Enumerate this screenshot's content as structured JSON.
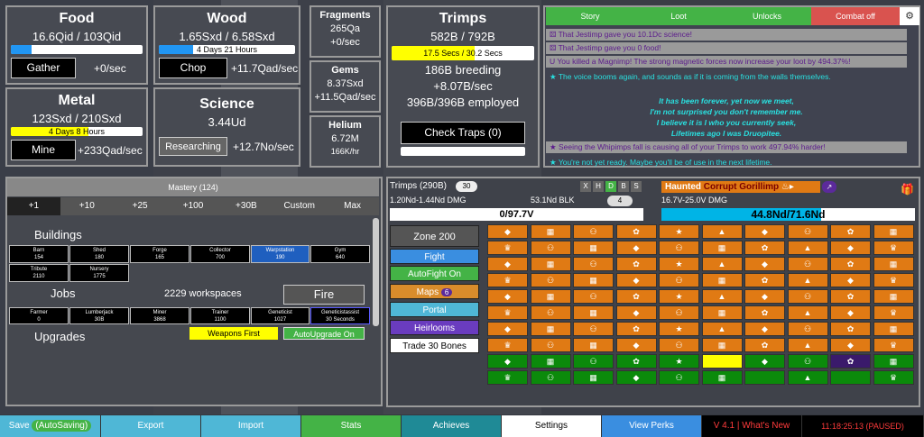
{
  "colors": {
    "accent_blue": "#2196f3",
    "yellow": "#ffff00",
    "orange": "#e07a14",
    "green": "#0b8a0b"
  },
  "food": {
    "title": "Food",
    "amount": "16.6Qid / 103Qid",
    "button": "Gather",
    "rate": "+0/sec",
    "fill": 0.16
  },
  "wood": {
    "title": "Wood",
    "amount": "1.65Sxd / 6.58Sxd",
    "bar_text": "4 Days 21 Hours",
    "button": "Chop",
    "rate": "+11.7Qad/sec",
    "fill": 0.25
  },
  "metal": {
    "title": "Metal",
    "amount": "123Sxd / 210Sxd",
    "bar_text": "4 Days 8 Hours",
    "button": "Mine",
    "rate": "+233Qad/sec",
    "fill": 0.59
  },
  "science": {
    "title": "Science",
    "amount": "3.44Ud",
    "button": "Researching",
    "rate": "+12.7No/sec"
  },
  "fragments": {
    "title": "Fragments",
    "amount": "265Qa",
    "rate": "+0/sec"
  },
  "gems": {
    "title": "Gems",
    "amount": "8.37Sxd",
    "rate": "+11.5Qad/sec"
  },
  "helium": {
    "title": "Helium",
    "amount": "6.72M",
    "rate": "166K/hr"
  },
  "trimps": {
    "title": "Trimps",
    "amount": "582B / 792B",
    "bar_text": "17.5 Secs / 30.2 Secs",
    "fill": 0.58,
    "breeding": "186B breeding",
    "rate": "+8.07B/sec",
    "employed": "396B/396B employed",
    "check_traps": "Check Traps (0)"
  },
  "log": {
    "tabs": [
      "Story",
      "Loot",
      "Unlocks",
      "Combat off"
    ],
    "lines": [
      "That Jestimp gave you 10.1Dc science!",
      "That Jestimp gave you 0 food!",
      "You killed a Magnimp! The strong magnetic forces now increase your loot by 494.37%!",
      "The voice booms again, and sounds as if it is coming from the walls themselves."
    ],
    "poem": [
      "It has been forever, yet now we meet,",
      "I'm not surprised you don't remember me.",
      "I believe it is I who you currently seek,",
      "Lifetimes ago I was Druopitee."
    ],
    "line5": "Seeing the Whipimps fall is causing all of your Trimps to work 497.94% harder!",
    "line6": "You're not yet ready. Maybe you'll be of use in the next lifetime."
  },
  "mastery": {
    "label": "Mastery (124)",
    "tabs": [
      "+1",
      "+10",
      "+25",
      "+100",
      "+30B",
      "Custom",
      "Max"
    ]
  },
  "buildings": {
    "heading": "Buildings",
    "items": [
      {
        "name": "Barn",
        "count": "154"
      },
      {
        "name": "Shed",
        "count": "180"
      },
      {
        "name": "Forge",
        "count": "165"
      },
      {
        "name": "Collector",
        "count": "700"
      },
      {
        "name": "Warpstation",
        "count": "190"
      },
      {
        "name": "Gym",
        "count": "640"
      },
      {
        "name": "Tribute",
        "count": "2110"
      },
      {
        "name": "Nursery",
        "count": "1775"
      }
    ]
  },
  "jobs": {
    "heading": "Jobs",
    "workspaces": "2229 workspaces",
    "fire": "Fire",
    "items": [
      {
        "name": "Farmer",
        "count": "0"
      },
      {
        "name": "Lumberjack",
        "count": "30B"
      },
      {
        "name": "Miner",
        "count": "3868"
      },
      {
        "name": "Trainer",
        "count": "1100"
      },
      {
        "name": "Geneticist",
        "count": "1027"
      },
      {
        "name": "Geneticistassist",
        "count": "30 Seconds"
      }
    ]
  },
  "upgrades": {
    "heading": "Upgrades",
    "weapons_first": "Weapons First",
    "autoupgrade": "AutoUpgrade On"
  },
  "battle": {
    "trimps_label": "Trimps (290B)",
    "trimps_badge": "30",
    "stance": [
      "X",
      "H",
      "D",
      "B",
      "S"
    ],
    "trimp_dmg": "1.20Nd-1.44Nd DMG",
    "trimp_blk": "53.1Nd BLK",
    "trimp_badge2": "4",
    "trimp_hp": "0/97.7V",
    "enemy_prefix": "Haunted",
    "enemy_name": "Corrupt Gorillimp",
    "enemy_dmg": "16.7V-25.0V DMG",
    "enemy_hp": "44.8Nd/71.6Nd",
    "enemy_hp_fill": 0.63
  },
  "controls": {
    "zone": "Zone 200",
    "fight": "Fight",
    "autofight": "AutoFight On",
    "maps": "Maps",
    "maps_count": "6",
    "portal": "Portal",
    "heirlooms": "Heirlooms",
    "trade": "Trade 30 Bones"
  },
  "grid_icons": [
    "◆",
    "▦",
    "⚇",
    "✿",
    "★",
    "▲",
    "◆",
    "⚇",
    "✿",
    "▦",
    "♛",
    "⚇",
    "▦",
    "◆",
    "⚇",
    "▦",
    "✿",
    "▲",
    "◆",
    "♛"
  ],
  "bottom": [
    "Save",
    "(AutoSaving)",
    "Export",
    "Import",
    "Stats",
    "Achieves",
    "Settings",
    "View Perks",
    "V 4.1 | What's New",
    "11:18:25:13 (PAUSED)"
  ]
}
